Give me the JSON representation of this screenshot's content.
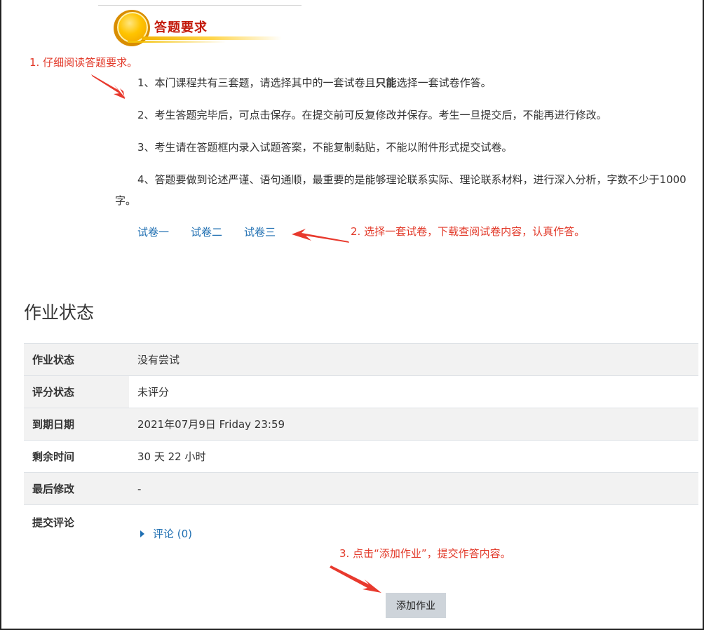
{
  "header": {
    "title": "答题要求"
  },
  "annotations": {
    "step1": "1. 仔细阅读答题要求。",
    "step2": "2. 选择一套试卷，下载查阅试卷内容，认真作答。",
    "step3": "3. 点击“添加作业”，提交作答内容。"
  },
  "requirements": {
    "r1_before": "1、本门课程共有三套题，请选择其中的一套试卷且",
    "r1_bold": "只能",
    "r1_after": "选择一套试卷作答。",
    "r2": "2、考生答题完毕后，可点击保存。在提交前可反复修改并保存。考生一旦提交后，不能再进行修改。",
    "r3": "3、考生请在答题框内录入试题答案，不能复制黏贴，不能以附件形式提交试卷。",
    "r4": "4、答题要做到论述严谨、语句通顺，最重要的是能够理论联系实际、理论联系材料，进行深入分析，字数不少于1000字。"
  },
  "papers": [
    "试卷一",
    "试卷二",
    "试卷三"
  ],
  "status": {
    "title": "作业状态",
    "rows": [
      {
        "label": "作业状态",
        "value": "没有尝试"
      },
      {
        "label": "评分状态",
        "value": "未评分"
      },
      {
        "label": "到期日期",
        "value": "2021年07月9日 Friday 23:59"
      },
      {
        "label": "剩余时间",
        "value": "30 天 22 小时"
      },
      {
        "label": "最后修改",
        "value": "-"
      }
    ],
    "comments_label": "提交评论",
    "comments_link": "评论 (0)"
  },
  "actions": {
    "add_submission": "添加作业"
  },
  "colors": {
    "annotation": "#e23a2a",
    "link": "#1f6fb2",
    "banner_title": "#c31a0b"
  }
}
